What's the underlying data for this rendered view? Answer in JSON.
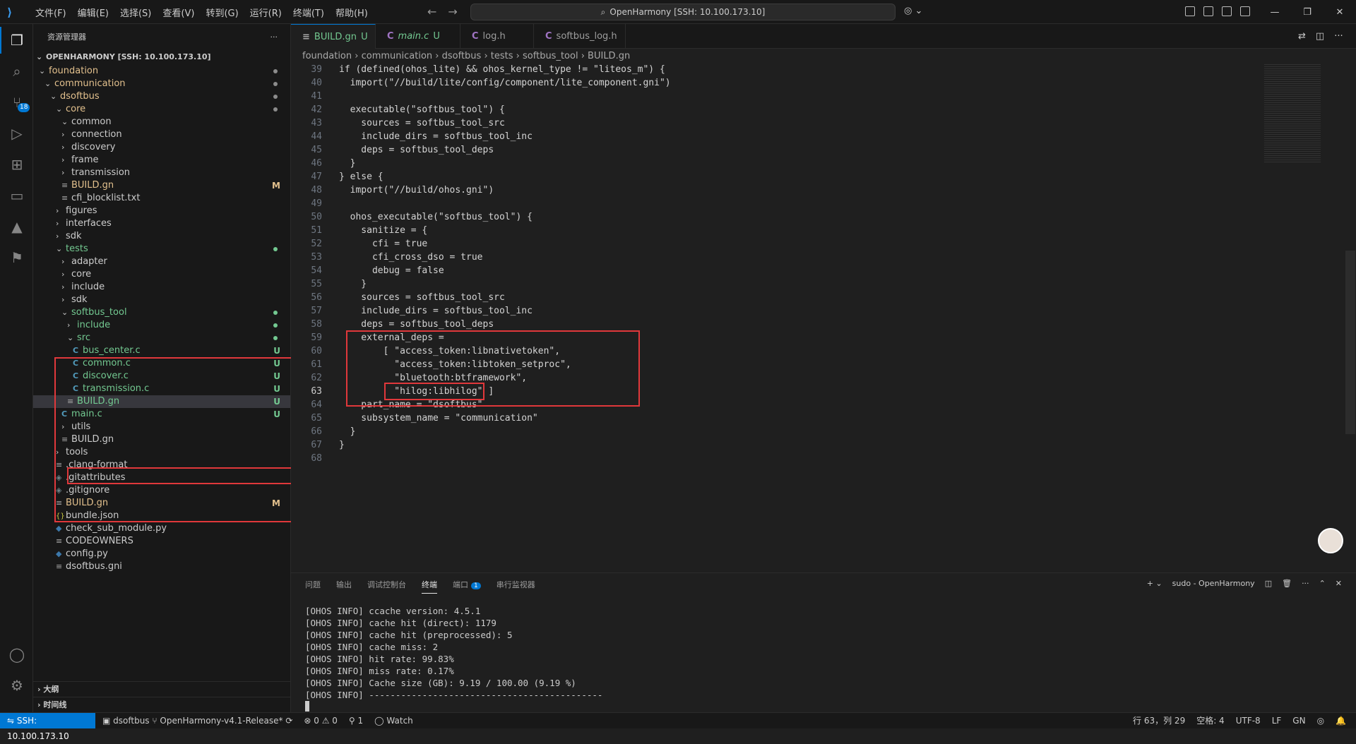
{
  "titlebar": {
    "menu": [
      "文件(F)",
      "编辑(E)",
      "选择(S)",
      "查看(V)",
      "转到(G)",
      "运行(R)",
      "终端(T)",
      "帮助(H)"
    ],
    "search": "OpenHarmony [SSH: 10.100.173.10]"
  },
  "activity": {
    "scm_badge": "18"
  },
  "sidebar": {
    "title": "资源管理器",
    "more": "···",
    "root": "OPENHARMONY [SSH: 10.100.173.10]",
    "tree": [
      {
        "label": "foundation",
        "color": "#e2c08d",
        "kind": "folder-open",
        "dot": "#8c8c8c"
      },
      {
        "label": "communication",
        "color": "#e2c08d",
        "kind": "folder-open",
        "dot": "#8c8c8c"
      },
      {
        "label": "dsoftbus",
        "color": "#e2c08d",
        "kind": "folder-open",
        "dot": "#8c8c8c"
      },
      {
        "label": "core",
        "color": "#e2c08d",
        "kind": "folder-open",
        "dot": "#8c8c8c"
      },
      {
        "label": "common",
        "color": "#cccccc",
        "kind": "folder-open"
      },
      {
        "label": "connection",
        "color": "#cccccc",
        "kind": "folder"
      },
      {
        "label": "discovery",
        "color": "#cccccc",
        "kind": "folder"
      },
      {
        "label": "frame",
        "color": "#cccccc",
        "kind": "folder"
      },
      {
        "label": "transmission",
        "color": "#cccccc",
        "kind": "folder"
      },
      {
        "label": "BUILD.gn",
        "color": "#e2c08d",
        "kind": "file",
        "status": "M"
      },
      {
        "label": "cfi_blocklist.txt",
        "color": "#cccccc",
        "kind": "file"
      },
      {
        "label": "figures",
        "color": "#cccccc",
        "kind": "folder"
      },
      {
        "label": "interfaces",
        "color": "#cccccc",
        "kind": "folder"
      },
      {
        "label": "sdk",
        "color": "#cccccc",
        "kind": "folder"
      },
      {
        "label": "tests",
        "color": "#73c991",
        "kind": "folder-open",
        "dot": "#73c991"
      },
      {
        "label": "adapter",
        "color": "#cccccc",
        "kind": "folder"
      },
      {
        "label": "core",
        "color": "#cccccc",
        "kind": "folder"
      },
      {
        "label": "include",
        "color": "#cccccc",
        "kind": "folder"
      },
      {
        "label": "sdk",
        "color": "#cccccc",
        "kind": "folder"
      },
      {
        "label": "softbus_tool",
        "color": "#73c991",
        "kind": "folder-open",
        "dot": "#73c991"
      },
      {
        "label": "include",
        "color": "#73c991",
        "kind": "folder",
        "dot": "#73c991"
      },
      {
        "label": "src",
        "color": "#73c991",
        "kind": "folder-open",
        "dot": "#73c991"
      },
      {
        "label": "bus_center.c",
        "color": "#73c991",
        "kind": "c",
        "status": "U"
      },
      {
        "label": "common.c",
        "color": "#73c991",
        "kind": "c",
        "status": "U"
      },
      {
        "label": "discover.c",
        "color": "#73c991",
        "kind": "c",
        "status": "U"
      },
      {
        "label": "transmission.c",
        "color": "#73c991",
        "kind": "c",
        "status": "U"
      },
      {
        "label": "BUILD.gn",
        "color": "#73c991",
        "kind": "file",
        "status": "U",
        "selected": true
      },
      {
        "label": "main.c",
        "color": "#73c991",
        "kind": "c",
        "status": "U"
      },
      {
        "label": "utils",
        "color": "#cccccc",
        "kind": "folder"
      },
      {
        "label": "BUILD.gn",
        "color": "#cccccc",
        "kind": "file"
      },
      {
        "label": "tools",
        "color": "#cccccc",
        "kind": "folder"
      },
      {
        "label": ".clang-format",
        "color": "#cccccc",
        "kind": "file"
      },
      {
        "label": ".gitattributes",
        "color": "#cccccc",
        "kind": "gear"
      },
      {
        "label": ".gitignore",
        "color": "#cccccc",
        "kind": "gear"
      },
      {
        "label": "BUILD.gn",
        "color": "#e2c08d",
        "kind": "file",
        "status": "M"
      },
      {
        "label": "bundle.json",
        "color": "#cccccc",
        "kind": "json"
      },
      {
        "label": "check_sub_module.py",
        "color": "#cccccc",
        "kind": "py"
      },
      {
        "label": "CODEOWNERS",
        "color": "#cccccc",
        "kind": "file"
      },
      {
        "label": "config.py",
        "color": "#cccccc",
        "kind": "py"
      },
      {
        "label": "dsoftbus.gni",
        "color": "#cccccc",
        "kind": "file"
      }
    ],
    "outline": "大纲",
    "timeline": "时间线"
  },
  "tabs": [
    {
      "label": "BUILD.gn",
      "status": "U",
      "active": true,
      "icon": "list-icon"
    },
    {
      "label": "main.c",
      "status": "U",
      "icon": "c-icon"
    },
    {
      "label": "log.h",
      "status": "",
      "icon": "c-icon"
    },
    {
      "label": "softbus_log.h",
      "status": "",
      "icon": "c-icon"
    }
  ],
  "breadcrumb": [
    "foundation",
    "communication",
    "dsoftbus",
    "tests",
    "softbus_tool",
    "BUILD.gn"
  ],
  "code": {
    "current_line": 63,
    "lines": [
      {
        "n": "39",
        "t": "if (defined(ohos_lite) && ohos_kernel_type != \"liteos_m\") {"
      },
      {
        "n": "40",
        "t": "  import(\"//build/lite/config/component/lite_component.gni\")"
      },
      {
        "n": "41",
        "t": ""
      },
      {
        "n": "42",
        "t": "  executable(\"softbus_tool\") {"
      },
      {
        "n": "43",
        "t": "    sources = softbus_tool_src"
      },
      {
        "n": "44",
        "t": "    include_dirs = softbus_tool_inc"
      },
      {
        "n": "45",
        "t": "    deps = softbus_tool_deps"
      },
      {
        "n": "46",
        "t": "  }"
      },
      {
        "n": "47",
        "t": "} else {"
      },
      {
        "n": "48",
        "t": "  import(\"//build/ohos.gni\")"
      },
      {
        "n": "49",
        "t": ""
      },
      {
        "n": "50",
        "t": "  ohos_executable(\"softbus_tool\") {"
      },
      {
        "n": "51",
        "t": "    sanitize = {"
      },
      {
        "n": "52",
        "t": "      cfi = true"
      },
      {
        "n": "53",
        "t": "      cfi_cross_dso = true"
      },
      {
        "n": "54",
        "t": "      debug = false"
      },
      {
        "n": "55",
        "t": "    }"
      },
      {
        "n": "56",
        "t": "    sources = softbus_tool_src"
      },
      {
        "n": "57",
        "t": "    include_dirs = softbus_tool_inc"
      },
      {
        "n": "58",
        "t": "    deps = softbus_tool_deps"
      },
      {
        "n": "59",
        "t": "    external_deps ="
      },
      {
        "n": "60",
        "t": "        [ \"access_token:libnativetoken\","
      },
      {
        "n": "61",
        "t": "          \"access_token:libtoken_setproc\","
      },
      {
        "n": "62",
        "t": "          \"bluetooth:btframework\","
      },
      {
        "n": "63",
        "t": "          \"hilog:libhilog\" ]"
      },
      {
        "n": "64",
        "t": "    part_name = \"dsoftbus\""
      },
      {
        "n": "65",
        "t": "    subsystem_name = \"communication\""
      },
      {
        "n": "66",
        "t": "  }"
      },
      {
        "n": "67",
        "t": "}"
      },
      {
        "n": "68",
        "t": ""
      }
    ]
  },
  "panel": {
    "tabs": [
      "问题",
      "输出",
      "调试控制台",
      "终端",
      "端口",
      "串行监视器"
    ],
    "active_tab": "终端",
    "ports_badge": "1",
    "terminal_name": "sudo - OpenHarmony",
    "terminal_lines": [
      "[OHOS INFO] ccache version: 4.5.1",
      "[OHOS INFO] cache hit (direct): 1179",
      "[OHOS INFO] cache hit (preprocessed): 5",
      "[OHOS INFO] cache miss: 2",
      "[OHOS INFO] hit rate: 99.83%",
      "[OHOS INFO] miss rate: 0.17%",
      "[OHOS INFO] Cache size (GB): 9.19 / 100.00 (9.19 %)",
      "[OHOS INFO] --------------------------------------------"
    ]
  },
  "statusbar": {
    "remote": "SSH: 10.100.173.10",
    "repo": "dsoftbus",
    "branch": "OpenHarmony-v4.1-Release*",
    "errors": "0",
    "warnings": "0",
    "ports": "1",
    "watch": "Watch",
    "position": "行 63，列 29",
    "spaces": "空格: 4",
    "encoding": "UTF-8",
    "eol": "LF",
    "lang": "GN"
  }
}
